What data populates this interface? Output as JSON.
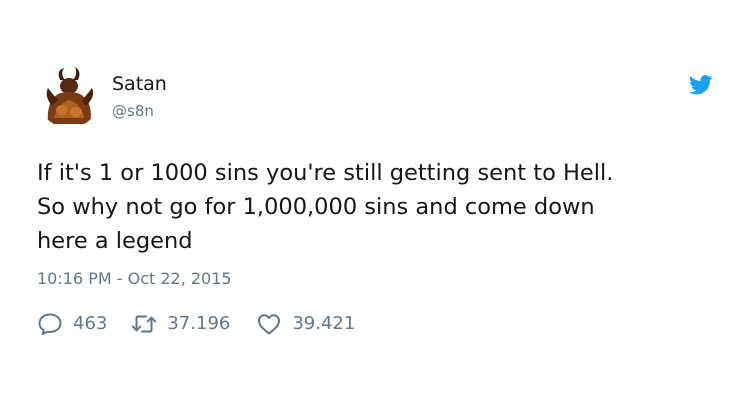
{
  "author": {
    "display_name": "Satan",
    "handle": "@s8n"
  },
  "tweet": {
    "text": "If it's 1 or 1000 sins you're still getting sent to Hell.\nSo why not go for 1,000,000 sins and come down\nhere a legend",
    "timestamp": "10:16 PM - Oct 22, 2015"
  },
  "stats": {
    "replies": "463",
    "retweets": "37.196",
    "likes": "39.421"
  },
  "icons": {
    "brand": "twitter-bird-icon",
    "reply": "reply-icon",
    "retweet": "retweet-icon",
    "like": "heart-icon"
  },
  "colors": {
    "twitter_blue": "#1da1f2",
    "text": "#14171a",
    "secondary_text": "#657786"
  }
}
